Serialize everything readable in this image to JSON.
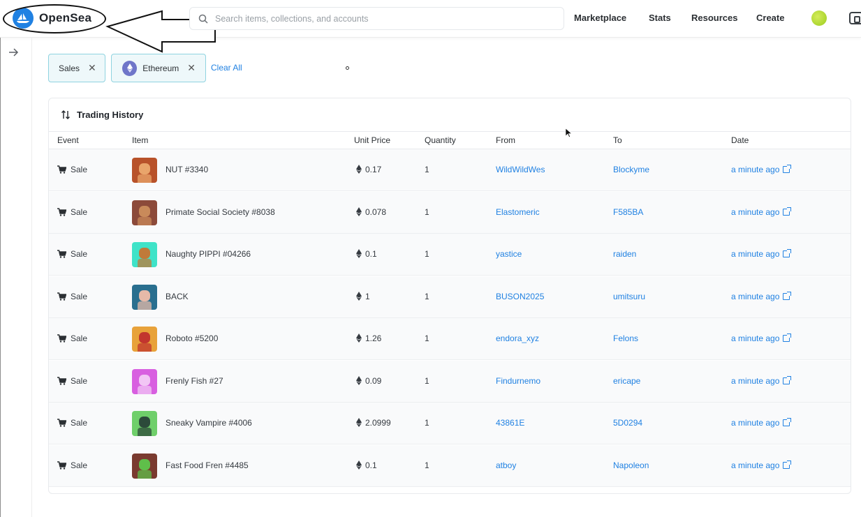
{
  "header": {
    "logo_text": "OpenSea",
    "search_placeholder": "Search items, collections, and accounts",
    "nav": [
      "Marketplace",
      "Stats",
      "Resources",
      "Create"
    ]
  },
  "filters": {
    "chips": [
      {
        "label": "Sales"
      },
      {
        "label": "Ethereum"
      }
    ],
    "clear_all": "Clear All"
  },
  "panel": {
    "title": "Trading History",
    "columns": [
      "Event",
      "Item",
      "Unit Price",
      "Quantity",
      "From",
      "To",
      "Date"
    ],
    "rows": [
      {
        "event": "Sale",
        "item": "NUT #3340",
        "price": "0.17",
        "quantity": "1",
        "from": "WildWildWes",
        "to": "Blockyme",
        "date": "a minute ago",
        "bg": "#b8522a",
        "fg": "#e9a56b"
      },
      {
        "event": "Sale",
        "item": "Primate Social Society #8038",
        "price": "0.078",
        "quantity": "1",
        "from": "Elastomeric",
        "to": "F585BA",
        "date": "a minute ago",
        "bg": "#8c4a3a",
        "fg": "#c98a5a"
      },
      {
        "event": "Sale",
        "item": "Naughty PIPPI #04266",
        "price": "0.1",
        "quantity": "1",
        "from": "yastice",
        "to": "raiden",
        "date": "a minute ago",
        "bg": "#3fe3c8",
        "fg": "#c07a3a"
      },
      {
        "event": "Sale",
        "item": "BACK",
        "price": "1",
        "quantity": "1",
        "from": "BUSON2025",
        "to": "umitsuru",
        "date": "a minute ago",
        "bg": "#2a6f8f",
        "fg": "#e6b9a8"
      },
      {
        "event": "Sale",
        "item": "Roboto #5200",
        "price": "1.26",
        "quantity": "1",
        "from": "endora_xyz",
        "to": "Felons",
        "date": "a minute ago",
        "bg": "#e8a23a",
        "fg": "#c2352e"
      },
      {
        "event": "Sale",
        "item": "Frenly Fish #27",
        "price": "0.09",
        "quantity": "1",
        "from": "Findurnemo",
        "to": "ericape",
        "date": "a minute ago",
        "bg": "#d85fe0",
        "fg": "#f2c6f5"
      },
      {
        "event": "Sale",
        "item": "Sneaky Vampire #4006",
        "price": "2.0999",
        "quantity": "1",
        "from": "43861E",
        "to": "5D0294",
        "date": "a minute ago",
        "bg": "#6fcf6a",
        "fg": "#2c4a3a"
      },
      {
        "event": "Sale",
        "item": "Fast Food Fren #4485",
        "price": "0.1",
        "quantity": "1",
        "from": "atboy",
        "to": "Napoleon",
        "date": "a minute ago",
        "bg": "#7a3a2f",
        "fg": "#5fbf4a"
      }
    ]
  },
  "colors": {
    "accent": "#2081e2",
    "chip_border": "#8fd3e0",
    "chip_bg": "#eef8fa"
  },
  "icons": [
    "opensea-logo-icon",
    "search-icon",
    "arrow-right-icon",
    "close-icon",
    "ethereum-icon",
    "sort-arrows-icon",
    "cart-icon",
    "external-link-icon",
    "wallet-icon"
  ]
}
